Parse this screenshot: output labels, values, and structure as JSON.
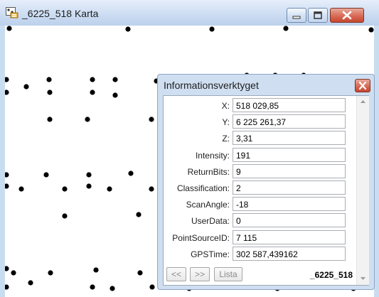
{
  "window": {
    "title": "_6225_518 Karta",
    "icons": {
      "app": "map-app-icon",
      "minimize": "minimize-icon",
      "maximize": "maximize-icon",
      "close": "close-icon"
    },
    "colors": {
      "frame": "#c9ddf1",
      "map_background": "#ffffff",
      "point": "#000000",
      "close_button": "#d0533d"
    }
  },
  "info_panel": {
    "title": "Informationsverktyget",
    "fields": [
      {
        "label": "X:",
        "value": "518 029,85"
      },
      {
        "label": "Y:",
        "value": "6 225 261,37"
      },
      {
        "label": "Z:",
        "value": "3,31"
      },
      {
        "label": "Intensity:",
        "value": "191"
      },
      {
        "label": "ReturnBits:",
        "value": "9"
      },
      {
        "label": "Classification:",
        "value": "2"
      },
      {
        "label": "ScanAngle:",
        "value": "-18"
      },
      {
        "label": "UserData:",
        "value": "0"
      },
      {
        "label": "PointSourceID:",
        "value": "7 115"
      },
      {
        "label": "GPSTime:",
        "value": "302 587,439162"
      }
    ],
    "footer": {
      "prev_label": "<<",
      "next_label": ">>",
      "list_label": "Lista",
      "file_name": "_6225_518"
    }
  }
}
